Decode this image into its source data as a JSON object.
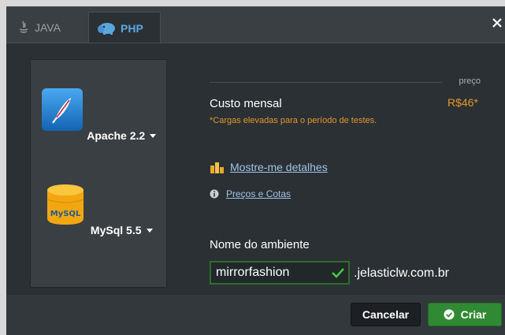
{
  "tabs": [
    {
      "label": "JAVA",
      "icon": "java-icon",
      "active": false
    },
    {
      "label": "PHP",
      "icon": "php-elephant-icon",
      "active": true
    }
  ],
  "stacks": {
    "apache": {
      "label": "Apache 2.2",
      "icon": "feather-icon"
    },
    "mysql": {
      "label": "MySql 5.5",
      "icon": "mysql-database-icon",
      "icon_text": "MySQL"
    }
  },
  "pricing": {
    "column_label": "preço",
    "title": "Custo mensal",
    "note": "*Cargas elevadas para o período de testes.",
    "price": "R$46*"
  },
  "links": {
    "details": "Mostre-me detalhes",
    "prices_quotas": "Preços e Cotas"
  },
  "environment": {
    "label": "Nome do ambiente",
    "value": "mirrorfashion",
    "domain": ".jelasticlw.com.br"
  },
  "buttons": {
    "cancel": "Cancelar",
    "create": "Criar"
  },
  "colors": {
    "accent_orange": "#e2962c",
    "link_blue": "#9fc4e6",
    "create_green": "#2f8a33",
    "tab_active_blue": "#5aa7e0"
  }
}
